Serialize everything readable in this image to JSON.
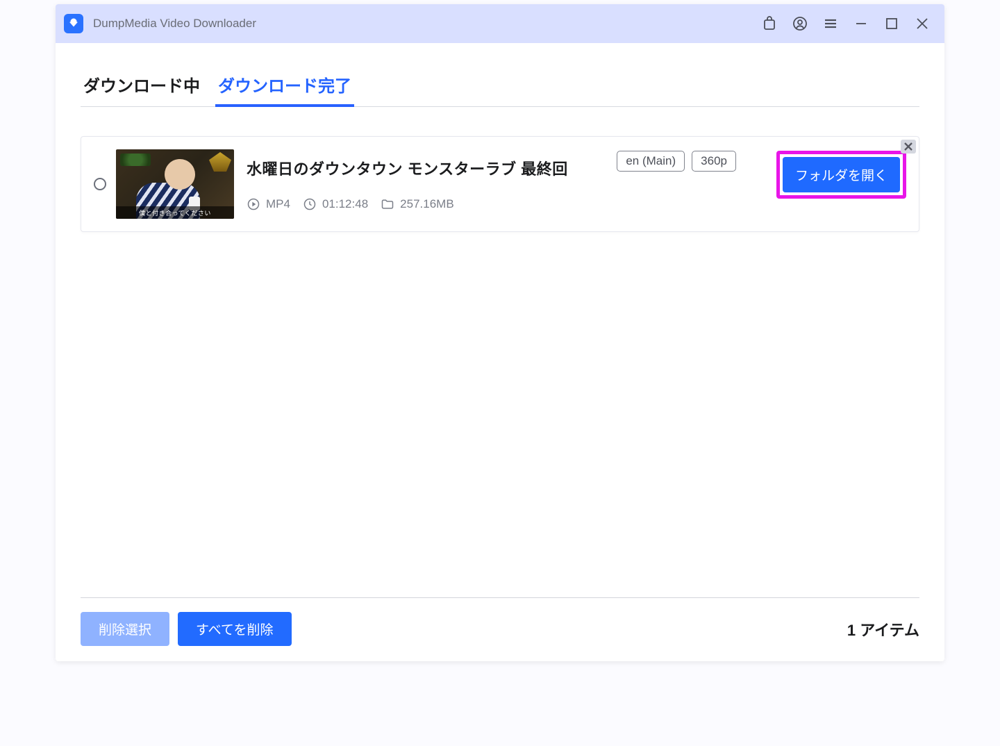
{
  "titlebar": {
    "app_name": "DumpMedia Video Downloader"
  },
  "tabs": {
    "downloading": "ダウンロード中",
    "completed": "ダウンロード完了"
  },
  "item": {
    "thumb_caption": "僕と付き合ってください",
    "title": "水曜日のダウンタウン モンスターラブ 最終回",
    "format": "MP4",
    "duration": "01:12:48",
    "size": "257.16MB",
    "lang_chip": "en (Main)",
    "quality_chip": "360p",
    "open_folder": "フォルダを開く"
  },
  "footer": {
    "delete_selected": "削除選択",
    "delete_all": "すべてを削除",
    "count": "1 アイテム"
  },
  "icons": {
    "store": "store-icon",
    "user": "user-icon",
    "menu": "menu-icon",
    "minimize": "minimize-icon",
    "maximize": "maximize-icon",
    "close": "close-icon"
  }
}
